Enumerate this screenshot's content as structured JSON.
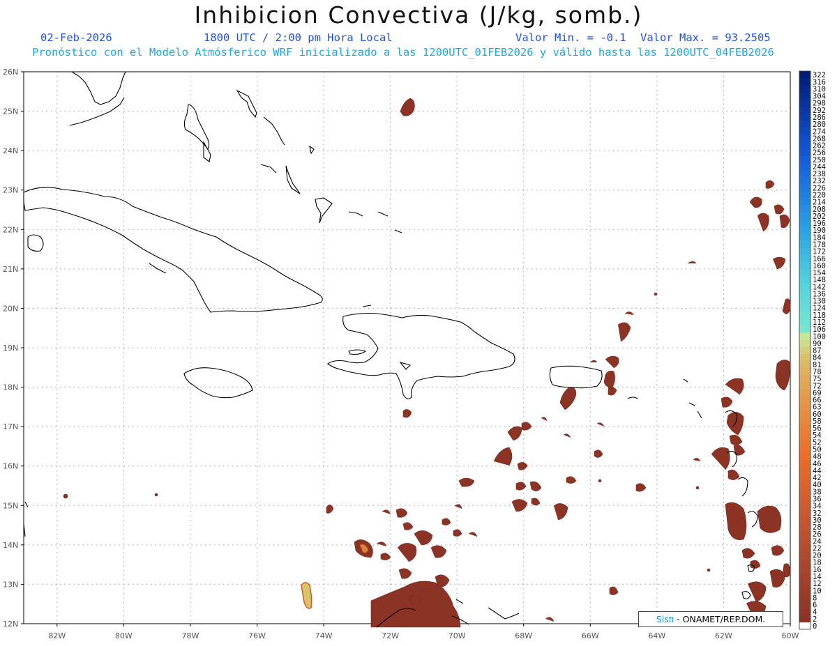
{
  "title": "Inhibicion Convectiva (J/kg, somb.)",
  "date": "02-Feb-2026",
  "time": "1800 UTC / 2:00 pm Hora Local",
  "min_label": "Valor Min. = -0.1",
  "max_label": "Valor Max. = 93.2505",
  "model_line": "Pronóstico con el Modelo Atmósferico WRF inicializado a las 1200UTC_01FEB2026 y válido hasta las  1200UTC_04FEB2026",
  "credit": {
    "brand": "Sisπ",
    "text": " - ONAMET/REP.DOM."
  },
  "map": {
    "lon_range": [
      -83,
      -60
    ],
    "lat_range": [
      12,
      26
    ],
    "lat_ticks": [
      "12N",
      "13N",
      "14N",
      "15N",
      "16N",
      "17N",
      "18N",
      "19N",
      "20N",
      "21N",
      "22N",
      "23N",
      "24N",
      "25N",
      "26N"
    ],
    "lon_ticks": [
      "82W",
      "80W",
      "78W",
      "76W",
      "74W",
      "72W",
      "70W",
      "68W",
      "66W",
      "64W",
      "62W",
      "60W"
    ],
    "gridlines": true,
    "field_color": "#8b3324"
  },
  "colorbar": {
    "labels": [
      "0",
      "2",
      "4",
      "6",
      "8",
      "10",
      "12",
      "14",
      "16",
      "18",
      "20",
      "22",
      "24",
      "26",
      "28",
      "30",
      "32",
      "34",
      "36",
      "38",
      "40",
      "42",
      "44",
      "46",
      "48",
      "50",
      "52",
      "54",
      "56",
      "58",
      "60",
      "63",
      "66",
      "69",
      "72",
      "75",
      "78",
      "81",
      "84",
      "87",
      "90",
      "100",
      "106",
      "112",
      "118",
      "124",
      "130",
      "136",
      "142",
      "148",
      "154",
      "160",
      "166",
      "172",
      "178",
      "184",
      "190",
      "196",
      "202",
      "208",
      "214",
      "220",
      "226",
      "232",
      "238",
      "244",
      "250",
      "256",
      "262",
      "268",
      "274",
      "280",
      "286",
      "292",
      "298",
      "304",
      "310",
      "316",
      "322"
    ]
  }
}
